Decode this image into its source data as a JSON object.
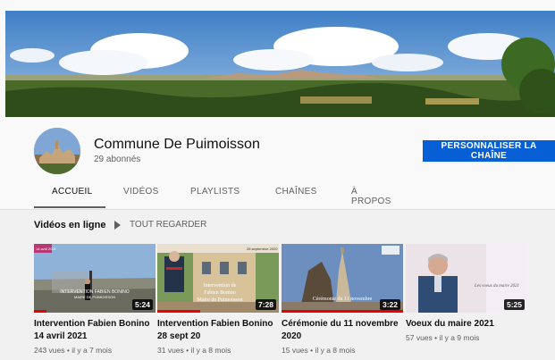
{
  "channel": {
    "name": "Commune De Puimoisson",
    "subscribers": "29 abonnés",
    "customize_label": "PERSONNALISER LA CHAÎNE"
  },
  "tabs": [
    {
      "label": "ACCUEIL",
      "active": true
    },
    {
      "label": "VIDÉOS",
      "active": false
    },
    {
      "label": "PLAYLISTS",
      "active": false
    },
    {
      "label": "CHAÎNES",
      "active": false
    },
    {
      "label": "À PROPOS",
      "active": false
    }
  ],
  "section": {
    "title": "Vidéos en ligne",
    "play_all_label": "TOUT REGARDER"
  },
  "videos": [
    {
      "title_line1": "Intervention Fabien Bonino",
      "title_line2": "14 avril 2021",
      "meta": "243 vues • il y a 7 mois",
      "duration": "5:24",
      "watched_fraction": 0.1
    },
    {
      "title_line1": "Intervention Fabien Bonino",
      "title_line2": "28 sept 20",
      "meta": "31 vues • il y a 8 mois",
      "duration": "7:28",
      "watched_fraction": 0.35
    },
    {
      "title_line1": "Cérémonie du 11 novembre",
      "title_line2": "2020",
      "meta": "15 vues • il y a 8 mois",
      "duration": "3:22",
      "watched_fraction": 1.0
    },
    {
      "title_line1": "Voeux du maire 2021",
      "title_line2": "",
      "meta": "57 vues • il y a 9 mois",
      "duration": "5:25",
      "watched_fraction": 0
    }
  ],
  "thumb_overlays": {
    "v1_caption_1": "INTERVENTION FABIEN BONINO",
    "v1_caption_2": "MAIRE DE PUIMOISSON",
    "v1_corner": "14 avril 2021",
    "v2_caption_1": "Intervention de",
    "v2_caption_2": "Fabien Bonino",
    "v2_caption_3": "Maire de Puimoisson",
    "v2_corner": "28 septembre 2020",
    "v3_caption": "Cérémonie du 11 novembre",
    "v4_caption": "Les voeux du maire 2021"
  },
  "colors": {
    "accent": "#065fd4",
    "progress": "#ee0000"
  }
}
